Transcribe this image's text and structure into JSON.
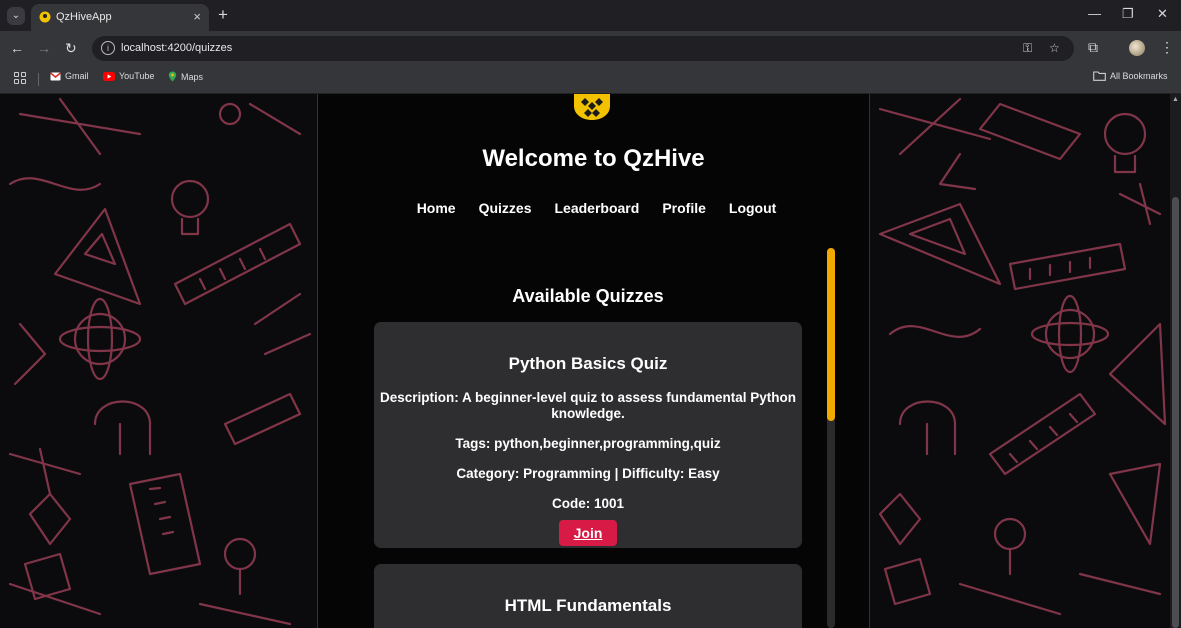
{
  "browser": {
    "tab_title": "QzHiveApp",
    "tab_close": "×",
    "new_tab": "+",
    "url": "localhost:4200/quizzes",
    "bookmarks": [
      {
        "label": "Gmail",
        "icon": "gmail-icon"
      },
      {
        "label": "YouTube",
        "icon": "youtube-icon"
      },
      {
        "label": "Maps",
        "icon": "maps-icon"
      }
    ],
    "all_bookmarks": "All Bookmarks"
  },
  "header": {
    "welcome": "Welcome to QzHive",
    "nav": [
      "Home",
      "Quizzes",
      "Leaderboard",
      "Profile",
      "Logout"
    ]
  },
  "main": {
    "section_title": "Available Quizzes",
    "quizzes": [
      {
        "title": "Python Basics Quiz",
        "description": "Description: A beginner-level quiz to assess fundamental Python knowledge.",
        "tags": "Tags: python,beginner,programming,quiz",
        "meta": "Category: Programming | Difficulty: Easy",
        "code": "Code: 1001",
        "join_label": "Join"
      },
      {
        "title": "HTML Fundamentals"
      }
    ]
  },
  "colors": {
    "accent_yellow": "#f2a900",
    "join_red": "#d81b46",
    "doodle_pink": "#8e3a4f",
    "card_bg": "#2e2e30"
  }
}
